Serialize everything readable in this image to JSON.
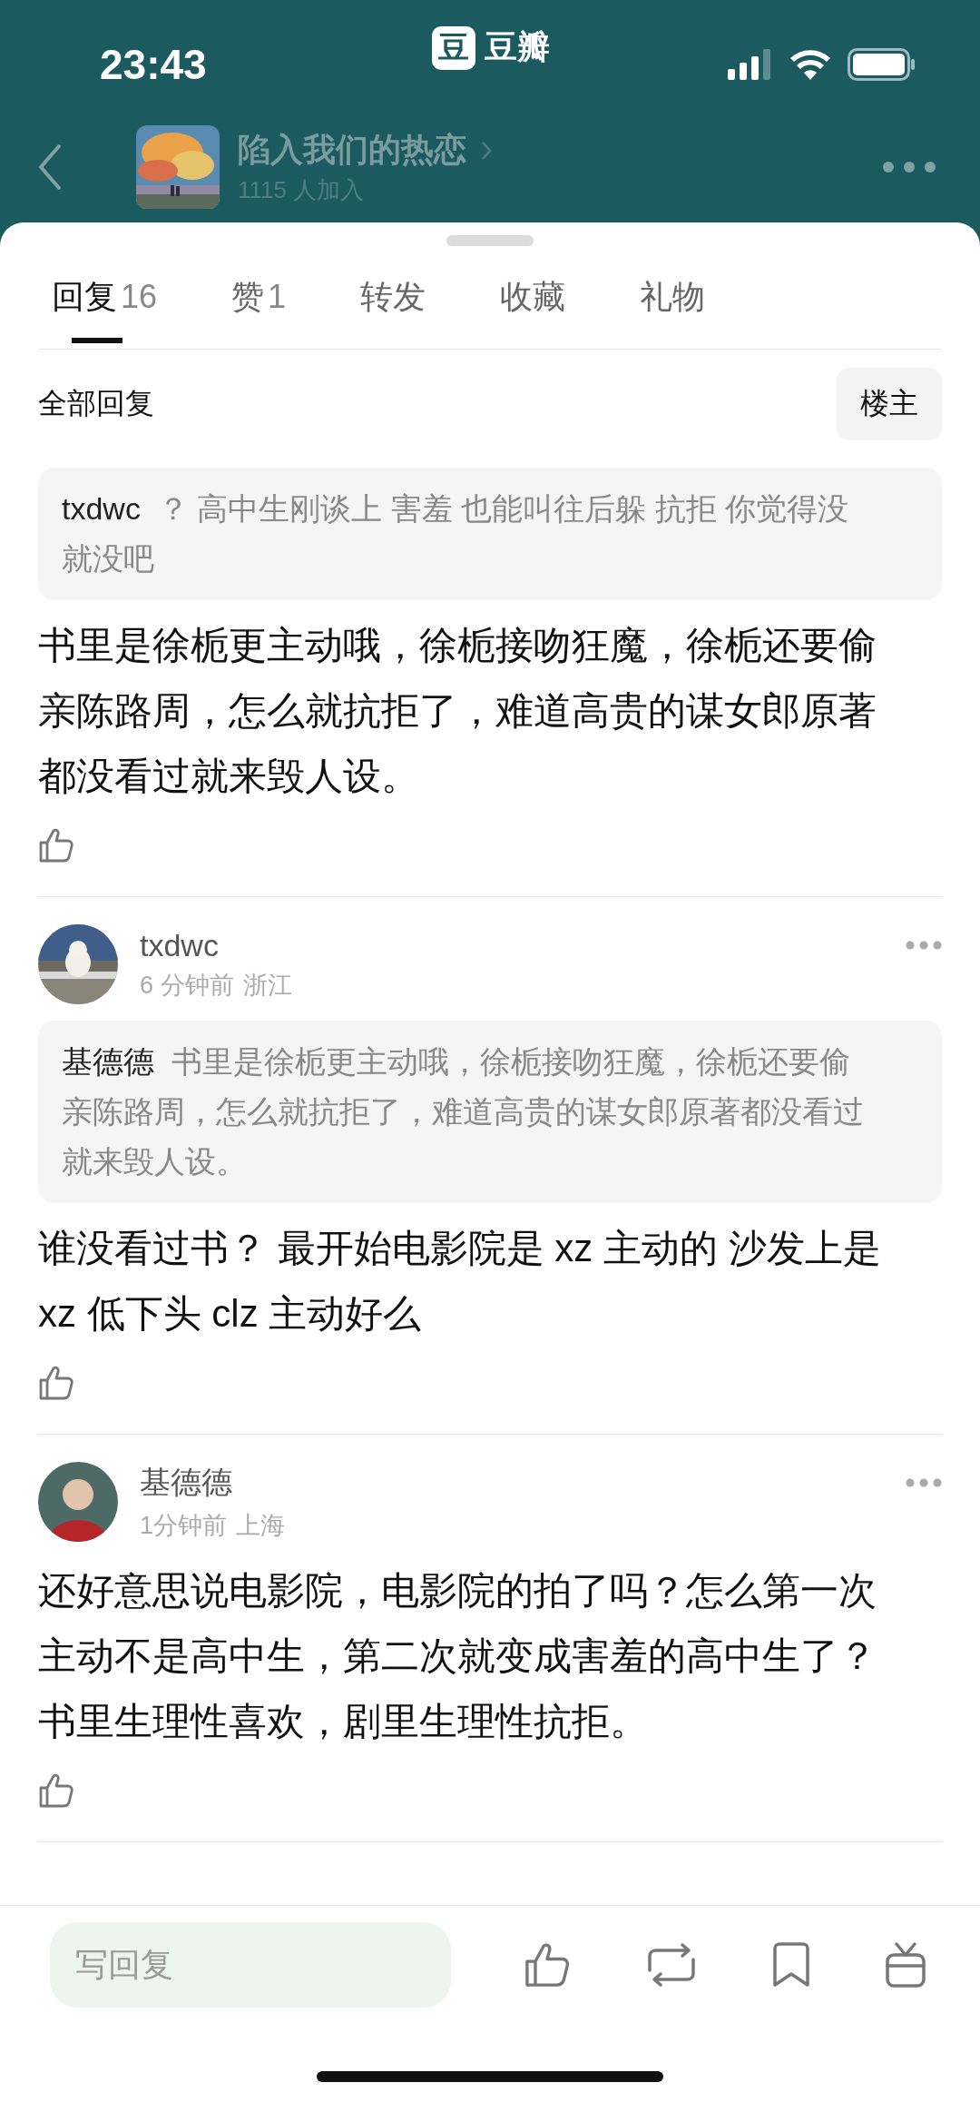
{
  "status_bar": {
    "time": "23:43",
    "logo_char": "豆",
    "app_name": "豆瓣"
  },
  "group": {
    "title": "陷入我们的热恋",
    "members": "1115 人加入"
  },
  "tabs": [
    {
      "label": "回复",
      "count": "16",
      "selected": true
    },
    {
      "label": "赞",
      "count": "1",
      "selected": false
    },
    {
      "label": "转发",
      "selected": false
    },
    {
      "label": "收藏",
      "selected": false
    },
    {
      "label": "礼物",
      "selected": false
    }
  ],
  "section": {
    "title": "全部回复",
    "filter": "楼主"
  },
  "comments": [
    {
      "quote": {
        "author": "txdwc",
        "text": "？ 高中生刚谈上 害羞 也能叫往后躲 抗拒 你觉得没就没吧"
      },
      "text": "书里是徐栀更主动哦，徐栀接吻狂魔，徐栀还要偷亲陈路周，怎么就抗拒了，难道高贵的谋女郎原著都没看过就来毁人设。"
    },
    {
      "author": "txdwc",
      "time": "6 分钟前",
      "location": "浙江",
      "quote": {
        "author": "基德德",
        "text": "书里是徐栀更主动哦，徐栀接吻狂魔，徐栀还要偷亲陈路周，怎么就抗拒了，难道高贵的谋女郎原著都没看过就来毁人设。"
      },
      "text": "谁没看过书？  最开始电影院是 xz 主动的 沙发上是 xz 低下头 clz 主动好么"
    },
    {
      "author": "基德德",
      "avatar": {
        "kind": "person"
      },
      "time": "1分钟前",
      "location": "上海",
      "text": "还好意思说电影院，电影院的拍了吗？怎么第一次主动不是高中生，第二次就变成害羞的高中生了？书里生理性喜欢，剧里生理性抗拒。"
    }
  ],
  "reply_bar": {
    "placeholder": "写回复"
  }
}
